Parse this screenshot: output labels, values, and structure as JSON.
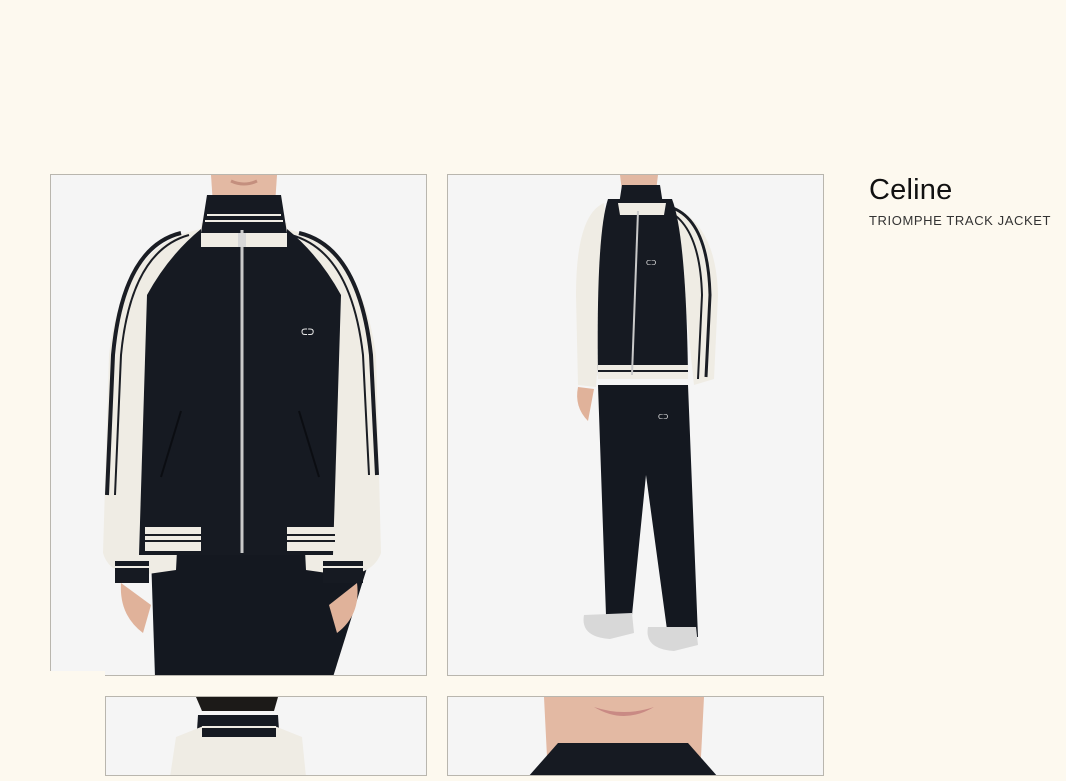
{
  "product": {
    "brand": "Celine",
    "name": "TRIOMPHE TRACK JACKET"
  },
  "gallery": [
    {
      "view": "front-closeup"
    },
    {
      "view": "full-body"
    },
    {
      "view": "back"
    },
    {
      "view": "collar-detail"
    }
  ],
  "colors": {
    "page_background": "#fdf9ef",
    "jacket_body": "#161a22",
    "sleeve_cream": "#efece4",
    "photo_background": "#f5f5f5"
  }
}
